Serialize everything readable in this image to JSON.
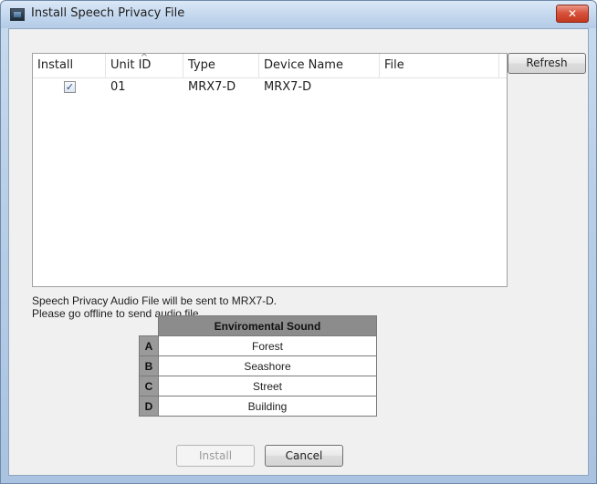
{
  "window": {
    "title": "Install Speech Privacy File",
    "close_glyph": "✕"
  },
  "list": {
    "columns": [
      "Install",
      "Unit ID",
      "Type",
      "Device Name",
      "File"
    ],
    "sort_indicator": "^",
    "rows": [
      {
        "install_checked": true,
        "check_glyph": "✓",
        "unit_id": "01",
        "type": "MRX7-D",
        "device_name": "MRX7-D",
        "file": ""
      }
    ]
  },
  "buttons": {
    "refresh": "Refresh",
    "install": "Install",
    "cancel": "Cancel"
  },
  "message": {
    "line1": "Speech Privacy Audio File will be sent to MRX7-D.",
    "line2": "Please go offline to send audio file."
  },
  "env_table": {
    "header": "Enviromental Sound",
    "rows": [
      {
        "key": "A",
        "value": "Forest"
      },
      {
        "key": "B",
        "value": "Seashore"
      },
      {
        "key": "C",
        "value": "Street"
      },
      {
        "key": "D",
        "value": "Building"
      }
    ]
  }
}
